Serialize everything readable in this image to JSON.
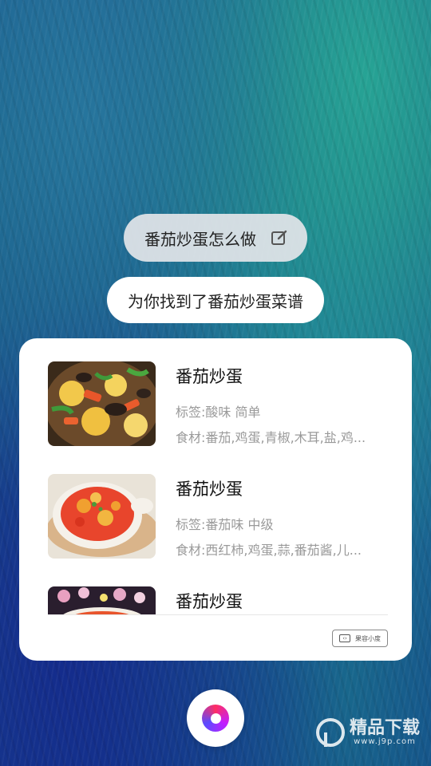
{
  "query_bubble": {
    "text": "番茄炒蛋怎么做",
    "icon": "edit-icon"
  },
  "reply_bubble": {
    "text": "为你找到了番茄炒蛋菜谱"
  },
  "recipes": [
    {
      "title": "番茄炒蛋",
      "tags": "标签:酸味 简单",
      "ingredients": "食材:番茄,鸡蛋,青椒,木耳,盐,鸡..."
    },
    {
      "title": "番茄炒蛋",
      "tags": "标签:番茄味 中级",
      "ingredients": "食材:西红柿,鸡蛋,蒜,番茄酱,儿..."
    },
    {
      "title": "番茄炒蛋",
      "tags": "",
      "ingredients": ""
    }
  ],
  "badge": {
    "text": "果容小度"
  },
  "mic": {
    "icon": "mic-icon"
  },
  "watermark": {
    "name": "精品下载",
    "url": "www.j9p.com"
  }
}
